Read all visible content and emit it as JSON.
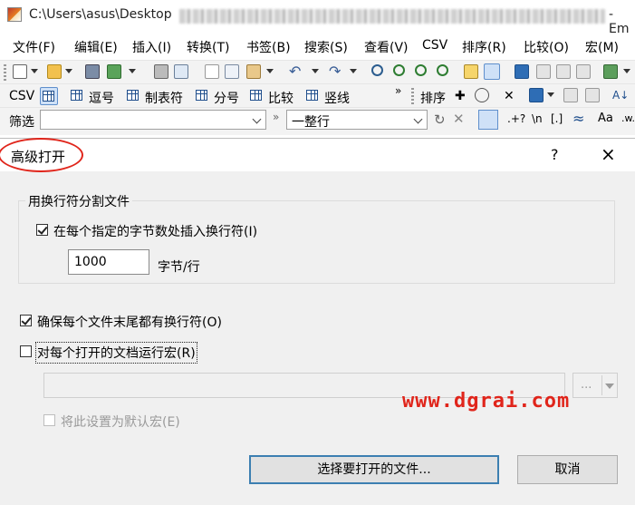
{
  "window": {
    "title_prefix": "C:\\Users\\asus\\Desktop",
    "title_suffix": "- Em"
  },
  "menu": [
    "文件(F)",
    "编辑(E)",
    "插入(I)",
    "转换(T)",
    "书签(B)",
    "搜索(S)",
    "查看(V)",
    "CSV",
    "排序(R)",
    "比较(O)",
    "宏(M)"
  ],
  "toolbar2": {
    "csv_label": "CSV",
    "items": [
      "逗号",
      "制表符",
      "分号",
      "比较",
      "竖线"
    ],
    "sort_label": "排序"
  },
  "filterbar": {
    "label": "筛选",
    "filter_value": "",
    "mode_value": "一整行"
  },
  "dialog": {
    "title": "高级打开",
    "help": "?",
    "close": "×",
    "group_title": "用换行符分割文件",
    "insert_newline_label": "在每个指定的字节数处插入换行符(I)",
    "insert_newline_checked": true,
    "bytes_value": "1000",
    "bytes_unit": "字节/行",
    "ensure_newline_label": "确保每个文件末尾都有换行符(O)",
    "ensure_newline_checked": true,
    "run_macro_label": "对每个打开的文档运行宏(R)",
    "run_macro_checked": false,
    "macro_value": "",
    "browse_label": "...",
    "default_macro_label": "将此设置为默认宏(E)",
    "default_macro_checked": false,
    "open_button": "选择要打开的文件...",
    "cancel_button": "取消"
  },
  "watermark": "www.dgrai.com",
  "colors": {
    "annotation_red": "#e0251b",
    "toolbar_bg": "#f3f3f3",
    "dialog_bg": "#f0f0f0",
    "primary_border": "#3c7fb1"
  }
}
